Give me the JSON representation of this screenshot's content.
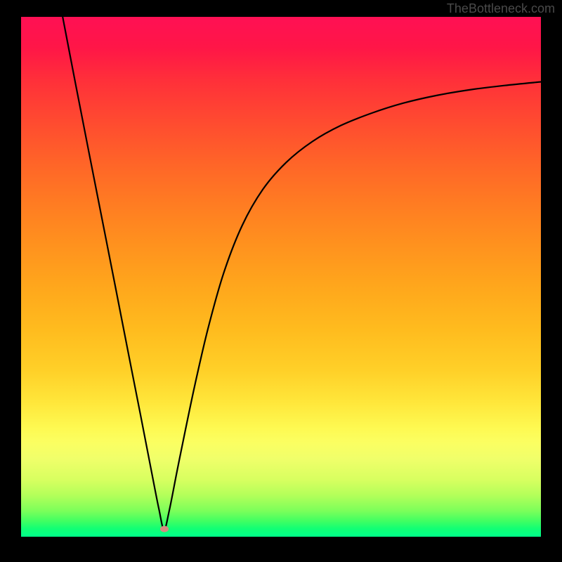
{
  "credit": "TheBottleneck.com",
  "chart_data": {
    "type": "line",
    "title": "",
    "xlabel": "",
    "ylabel": "",
    "xlim": [
      0,
      100
    ],
    "ylim": [
      0,
      100
    ],
    "grid": false,
    "legend": false,
    "marker": {
      "x": 27.5,
      "y": 1.5,
      "color": "#d58a80"
    },
    "series": [
      {
        "name": "curve",
        "color": "#000000",
        "x": [
          8.0,
          10.5,
          13.0,
          15.5,
          18.0,
          20.5,
          23.0,
          25.0,
          26.5,
          27.5,
          28.5,
          30.0,
          31.5,
          33.5,
          36.0,
          39.0,
          42.5,
          46.5,
          51.0,
          56.0,
          61.5,
          67.5,
          73.5,
          80.0,
          86.5,
          93.0,
          100.0
        ],
        "y": [
          100.0,
          87.0,
          74.2,
          61.5,
          48.8,
          36.0,
          23.3,
          13.0,
          5.4,
          1.4,
          5.0,
          12.6,
          20.0,
          29.5,
          40.2,
          50.8,
          59.8,
          66.8,
          72.0,
          76.0,
          79.1,
          81.5,
          83.4,
          84.9,
          86.0,
          86.8,
          87.5
        ]
      }
    ],
    "background_gradient": {
      "type": "vertical",
      "stops": [
        {
          "pos": 0,
          "color": "#ff1054"
        },
        {
          "pos": 20,
          "color": "#ff4a30"
        },
        {
          "pos": 44,
          "color": "#ff921e"
        },
        {
          "pos": 68,
          "color": "#ffd028"
        },
        {
          "pos": 82,
          "color": "#fbff62"
        },
        {
          "pos": 95,
          "color": "#7cff5a"
        },
        {
          "pos": 100,
          "color": "#00ff8a"
        }
      ]
    }
  }
}
